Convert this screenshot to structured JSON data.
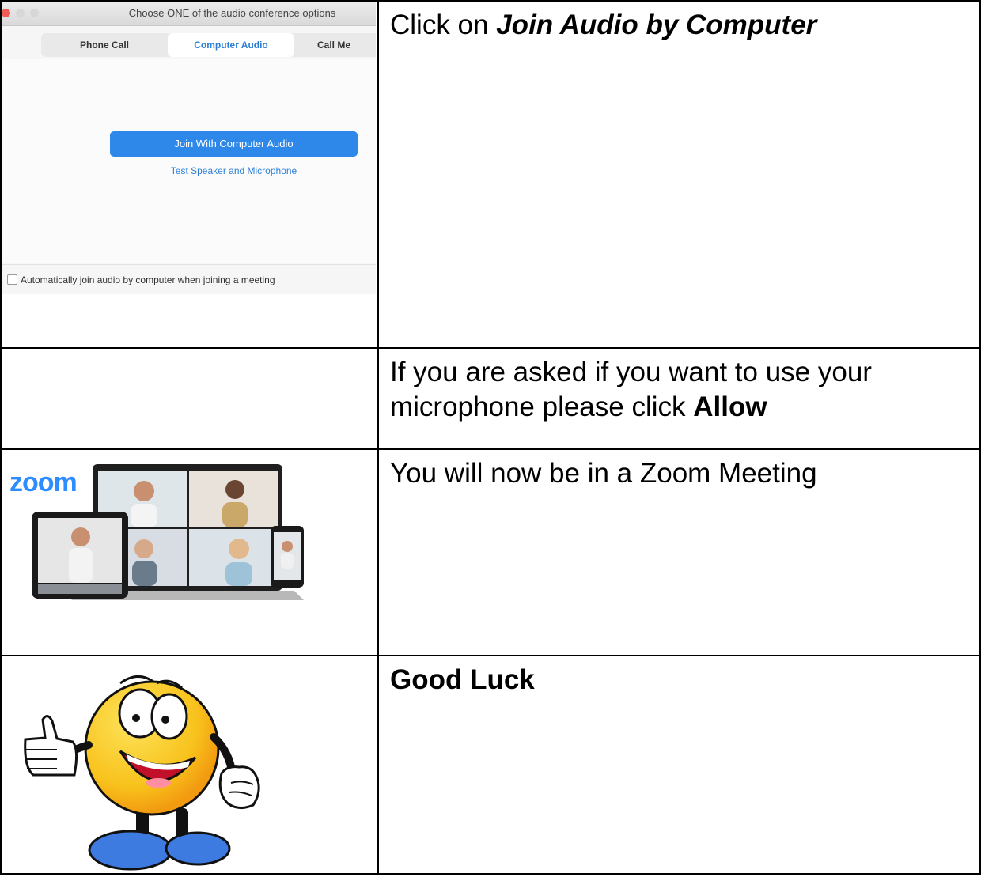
{
  "dialog": {
    "title": "Choose ONE of the audio conference options",
    "tabs": [
      "Phone Call",
      "Computer Audio",
      "Call Me"
    ],
    "join_button": "Join With Computer Audio",
    "test_link": "Test Speaker and Microphone",
    "auto_join_label": "Automatically join audio by computer when joining a meeting"
  },
  "logo_text": "zoom",
  "steps": [
    {
      "prefix": "Click on ",
      "emphasis": "Join Audio by Computer"
    },
    {
      "prefix": "If you are asked if you want to use your microphone please click ",
      "emphasis": "Allow"
    },
    {
      "text": "You will now be in a Zoom Meeting"
    },
    {
      "emphasis": "Good Luck"
    }
  ],
  "colors": {
    "accent_blue": "#2d88ea",
    "zoom_blue": "#2d8cff",
    "smiley_yellow": "#f8c21c",
    "shoe_blue": "#3d7be0"
  }
}
